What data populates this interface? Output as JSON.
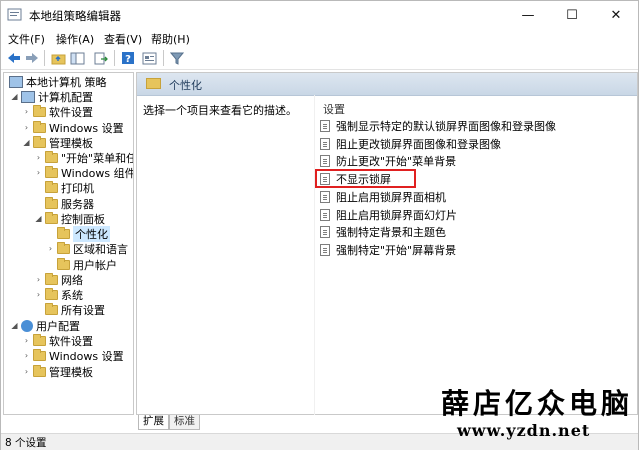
{
  "window": {
    "title": "本地组策略编辑器"
  },
  "menu": [
    "文件(F)",
    "操作(A)",
    "查看(V)",
    "帮助(H)"
  ],
  "tree": {
    "root": "本地计算机 策略",
    "computer_config": "计算机配置",
    "items": {
      "software_settings": "软件设置",
      "windows_settings": "Windows 设置",
      "admin_templates": "管理模板",
      "start_menu": "\"开始\"菜单和任",
      "windows_components": "Windows 组件",
      "printers": "打印机",
      "server": "服务器",
      "control_panel": "控制面板",
      "personalization": "个性化",
      "regional": "区域和语言",
      "user_accounts": "用户帐户",
      "network": "网络",
      "system": "系统",
      "all_settings": "所有设置"
    },
    "user_config": "用户配置",
    "user_items": {
      "software_settings": "软件设置",
      "windows_settings": "Windows 设置",
      "admin_templates": "管理模板"
    }
  },
  "right": {
    "header": "个性化",
    "description": "选择一个项目来查看它的描述。",
    "column_header": "设置",
    "settings": [
      "强制显示特定的默认锁屏界面图像和登录图像",
      "阻止更改锁屏界面图像和登录图像",
      "防止更改\"开始\"菜单背景",
      "不显示锁屏",
      "阻止启用锁屏界面相机",
      "阻止启用锁屏界面幻灯片",
      "强制特定背景和主题色",
      "强制特定\"开始\"屏幕背景"
    ]
  },
  "tabs": [
    "扩展",
    "标准"
  ],
  "status": "8 个设置",
  "watermark": {
    "brand": "薛店亿众电脑",
    "url": "www.yzdn.net"
  }
}
